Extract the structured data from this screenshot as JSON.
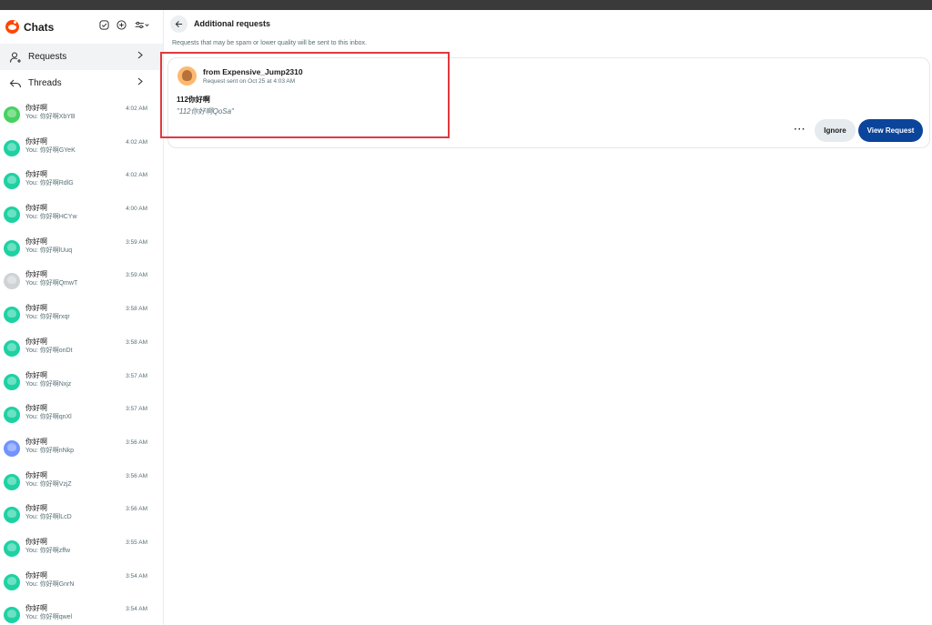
{
  "app": {
    "title": "Chats"
  },
  "sidebar": {
    "nav": [
      {
        "label": "Requests",
        "icon": "add-user-icon"
      },
      {
        "label": "Threads",
        "icon": "reply-icon"
      }
    ],
    "chats": [
      {
        "name": "你好啊",
        "preview": "You: 你好啊XbYB",
        "time": "4:02 AM",
        "avatar": "green"
      },
      {
        "name": "你好啊",
        "preview": "You: 你好啊GYeK",
        "time": "4:02 AM",
        "avatar": "teal"
      },
      {
        "name": "你好啊",
        "preview": "You: 你好啊RdlG",
        "time": "4:02 AM",
        "avatar": "teal"
      },
      {
        "name": "你好啊",
        "preview": "You: 你好啊HCYw",
        "time": "4:00 AM",
        "avatar": "teal"
      },
      {
        "name": "你好啊",
        "preview": "You: 你好啊lUuq",
        "time": "3:59 AM",
        "avatar": "teal"
      },
      {
        "name": "你好啊",
        "preview": "You: 你好啊QmwT",
        "time": "3:59 AM",
        "avatar": "gray"
      },
      {
        "name": "你好啊",
        "preview": "You: 你好啊rxqr",
        "time": "3:58 AM",
        "avatar": "teal"
      },
      {
        "name": "你好啊",
        "preview": "You: 你好啊onDt",
        "time": "3:58 AM",
        "avatar": "teal"
      },
      {
        "name": "你好啊",
        "preview": "You: 你好啊Nxjz",
        "time": "3:57 AM",
        "avatar": "teal"
      },
      {
        "name": "你好啊",
        "preview": "You: 你好啊qnXl",
        "time": "3:57 AM",
        "avatar": "teal"
      },
      {
        "name": "你好啊",
        "preview": "You: 你好啊nNkp",
        "time": "3:56 AM",
        "avatar": "blue"
      },
      {
        "name": "你好啊",
        "preview": "You: 你好啊VzjZ",
        "time": "3:56 AM",
        "avatar": "teal"
      },
      {
        "name": "你好啊",
        "preview": "You: 你好啊lLcD",
        "time": "3:56 AM",
        "avatar": "teal"
      },
      {
        "name": "你好啊",
        "preview": "You: 你好啊zffw",
        "time": "3:55 AM",
        "avatar": "teal"
      },
      {
        "name": "你好啊",
        "preview": "You: 你好啊GnrN",
        "time": "3:54 AM",
        "avatar": "teal"
      },
      {
        "name": "你好啊",
        "preview": "You: 你好啊qwel",
        "time": "3:54 AM",
        "avatar": "teal"
      }
    ]
  },
  "main": {
    "title": "Additional requests",
    "notice": "Requests that may be spam or lower quality will be sent to this inbox.",
    "request": {
      "from": "from Expensive_Jump2310",
      "date": "Request sent on Oct 25 at 4:03 AM",
      "message": "112你好啊",
      "quote": "\"112你好啊QoSa\"",
      "more_label": "···",
      "ignore_label": "Ignore",
      "view_label": "View Request"
    }
  },
  "colors": {
    "accent": "#0a449b",
    "brand": "#ff4500",
    "highlight": "#e0393e"
  }
}
